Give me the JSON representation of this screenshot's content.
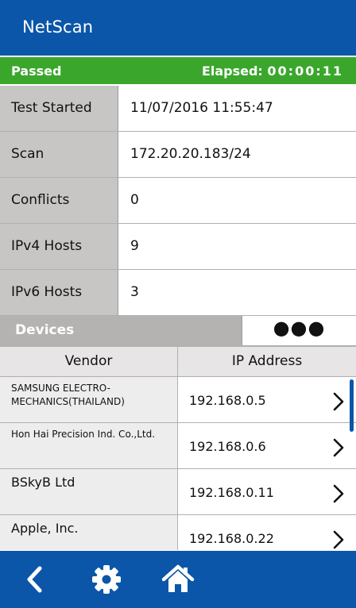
{
  "app": {
    "title": "NetScan"
  },
  "status": {
    "result": "Passed",
    "elapsed_label": "Elapsed:",
    "elapsed_value": "00:00:11"
  },
  "summary": [
    {
      "label": "Test Started",
      "value": "11/07/2016 11:55:47"
    },
    {
      "label": "Scan",
      "value": "172.20.20.183/24"
    },
    {
      "label": "Conflicts",
      "value": "0"
    },
    {
      "label": "IPv4 Hosts",
      "value": "9"
    },
    {
      "label": "IPv6 Hosts",
      "value": "3"
    }
  ],
  "devices": {
    "tab_label": "Devices",
    "more_label": "●●●",
    "columns": [
      "Vendor",
      "IP Address"
    ],
    "rows": [
      {
        "vendor": "SAMSUNG ELECTRO-MECHANICS(THAILAND)",
        "ip": "192.168.0.5"
      },
      {
        "vendor": "Hon Hai Precision Ind. Co.,Ltd.",
        "ip": "192.168.0.6"
      },
      {
        "vendor": "BSkyB Ltd",
        "ip": "192.168.0.11"
      },
      {
        "vendor": "Apple, Inc.",
        "ip": "192.168.0.22"
      }
    ]
  },
  "footer": {
    "icons": [
      "back-icon",
      "gear-icon",
      "home-icon"
    ]
  },
  "colors": {
    "brand_blue": "#0b56a8",
    "passed_green": "#3aa72c",
    "label_gray": "#c8c5c5"
  }
}
